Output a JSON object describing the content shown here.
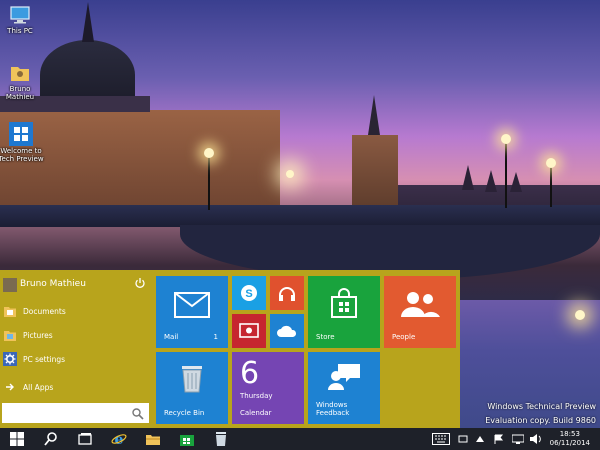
{
  "desktop": {
    "icons": [
      {
        "label": "This PC",
        "icon": "this-pc-icon"
      },
      {
        "label": "Bruno Mathieu",
        "icon": "user-folder-icon"
      },
      {
        "label": "Welcome to Tech Preview",
        "icon": "welcome-tech-preview-icon"
      }
    ],
    "watermark": {
      "line1": "Windows Technical Preview",
      "line2": "Evaluation copy. Build 9860"
    }
  },
  "start_menu": {
    "user_name": "Bruno Mathieu",
    "power_icon": "power-icon",
    "items": [
      {
        "label": "Documents",
        "icon": "documents-folder-icon"
      },
      {
        "label": "Pictures",
        "icon": "pictures-folder-icon"
      },
      {
        "label": "PC settings",
        "icon": "gear-icon"
      }
    ],
    "all_apps": "All Apps",
    "search_placeholder": "",
    "tiles": [
      {
        "name": "mail",
        "label": "Mail",
        "badge": "1",
        "color": "#1e82d2"
      },
      {
        "name": "skype",
        "label": "",
        "color": "#1aa0e4"
      },
      {
        "name": "music",
        "label": "",
        "color": "#e0512e"
      },
      {
        "name": "video",
        "label": "",
        "color": "#c6262f"
      },
      {
        "name": "onedrive",
        "label": "",
        "color": "#1e82d2"
      },
      {
        "name": "store",
        "label": "Store",
        "color": "#19a33d"
      },
      {
        "name": "people",
        "label": "People",
        "color": "#e25a30"
      },
      {
        "name": "recycle-bin",
        "label": "Recycle Bin",
        "color": "#1e82d2"
      },
      {
        "name": "calendar",
        "label": "Calendar",
        "day_number": "6",
        "weekday": "Thursday",
        "color": "#7545b3"
      },
      {
        "name": "windows-feedback",
        "label": "Windows Feedback",
        "color": "#1e82d2"
      }
    ]
  },
  "taskbar": {
    "clock_time": "18:53",
    "clock_date": "06/11/2014"
  },
  "colors": {
    "start_menu_bg": "#b8a41c",
    "taskbar_bg": "#1e2129"
  }
}
